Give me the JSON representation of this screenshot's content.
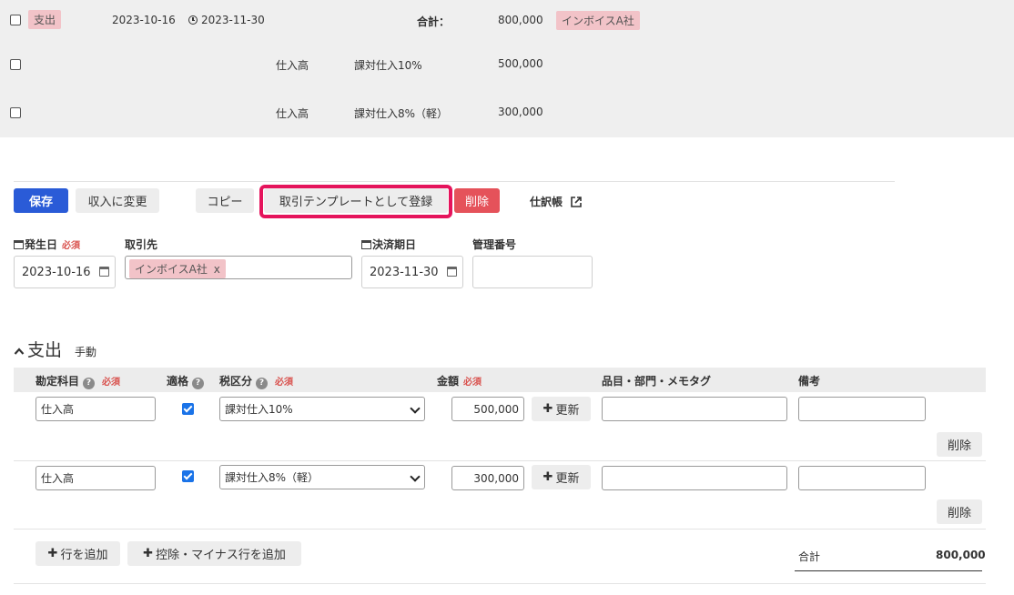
{
  "summary": {
    "main_row": {
      "type_tag": "支出",
      "issue_date": "2023-10-16",
      "due_date": "2023-11-30",
      "total_label": "合計：",
      "total_value": "800,000",
      "partner_tag": "インボイスA社"
    },
    "lines": [
      {
        "account": "仕入高",
        "tax": "課対仕入10%",
        "amount": "500,000"
      },
      {
        "account": "仕入高",
        "tax": "課対仕入8%（軽）",
        "amount": "300,000"
      }
    ]
  },
  "toolbar": {
    "save": "保存",
    "change_income": "収入に変更",
    "copy": "コピー",
    "register_template": "取引テンプレートとして登録",
    "delete": "削除",
    "journal": "仕訳帳"
  },
  "form": {
    "issue_date_label": "発生日",
    "required": "必須",
    "issue_date_value": "2023-10-16",
    "partner_label": "取引先",
    "partner_tag": "インボイスA社",
    "partner_tag_remove": "x",
    "due_date_label": "決済期日",
    "due_date_value": "2023-11-30",
    "manage_no_label": "管理番号",
    "manage_no_value": ""
  },
  "section": {
    "title": "支出",
    "mode": "手動"
  },
  "table": {
    "headers": {
      "account": "勘定科目",
      "qualified": "適格",
      "tax": "税区分",
      "amount": "金額",
      "items": "品目・部門・メモタグ",
      "note": "備考"
    },
    "rows": [
      {
        "account": "仕入高",
        "qualified": true,
        "tax": "課対仕入10%",
        "amount": "500,000",
        "update": "更新",
        "items": "",
        "note": "",
        "delete": "削除"
      },
      {
        "account": "仕入高",
        "qualified": true,
        "tax": "課対仕入8%（軽）",
        "amount": "300,000",
        "update": "更新",
        "items": "",
        "note": "",
        "delete": "削除"
      }
    ]
  },
  "footer": {
    "add_row": "行を追加",
    "add_deduction_row": "控除・マイナス行を追加",
    "total_label": "合計",
    "total_value": "800,000"
  },
  "colors": {
    "primary": "#2a5bd7",
    "danger": "#e5525a",
    "highlight": "#e5145c",
    "tag_pink": "#f2c3c8",
    "required": "#d9534f"
  },
  "icons": [
    "clock-icon",
    "external-link-icon",
    "calendar-icon",
    "chevron-up-icon",
    "help-icon",
    "plus-icon",
    "chevron-down-icon"
  ]
}
